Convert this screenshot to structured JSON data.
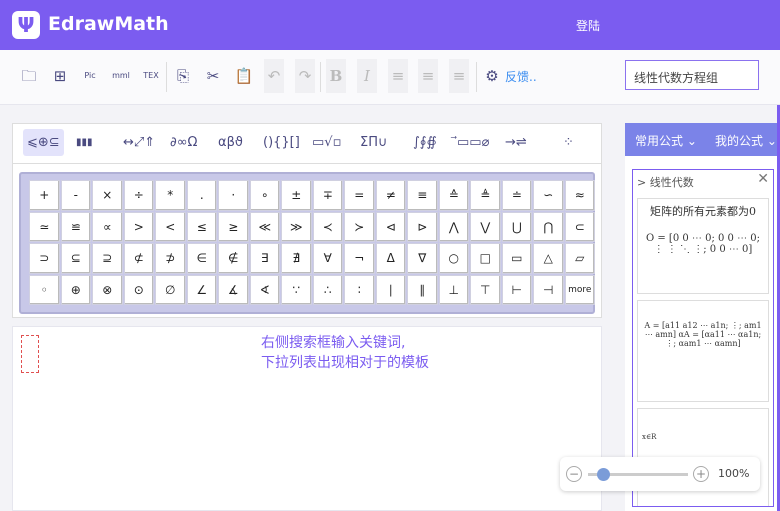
{
  "header": {
    "logo": "Ψ",
    "app_name": "EdrawMath",
    "login": "登陆"
  },
  "toolbar": {
    "items": [
      "open-folder",
      "new-file",
      "export-pic",
      "export-mml",
      "export-tex",
      "copy",
      "cut",
      "paste",
      "undo",
      "redo",
      "bold",
      "italic",
      "align-left",
      "align-center",
      "align-right"
    ],
    "feedback": "反馈..",
    "search_value": "线性代数方程组"
  },
  "symbol_tabs": [
    "⩽⊕⊆",
    "▮▮▮",
    "↔⤢⇑",
    "∂∞Ω",
    "αβϑ",
    "(){}[]",
    "▭√▫",
    "ΣΠ∪",
    "∫∮∯",
    "⃗▭▭⌀",
    "→⇌",
    "⁘"
  ],
  "symbols": [
    [
      "+",
      "-",
      "×",
      "÷",
      "*",
      ".",
      "·",
      "∘",
      "±",
      "∓",
      "=",
      "≠",
      "≡",
      "≙",
      "≜",
      "≐",
      "∽",
      "≈"
    ],
    [
      "≃",
      "≌",
      "∝",
      ">",
      "<",
      "≤",
      "≥",
      "≪",
      "≫",
      "≺",
      "≻",
      "⊲",
      "⊳",
      "⋀",
      "⋁",
      "⋃",
      "⋂",
      "⊂"
    ],
    [
      "⊃",
      "⊆",
      "⊇",
      "⊄",
      "⊅",
      "∈",
      "∉",
      "∃",
      "∄",
      "∀",
      "¬",
      "Δ",
      "∇",
      "○",
      "□",
      "▭",
      "△",
      "▱"
    ],
    [
      "◦",
      "⊕",
      "⊗",
      "⊙",
      "∅",
      "∠",
      "∡",
      "∢",
      "∵",
      "∴",
      "∶",
      "∣",
      "∥",
      "⊥",
      "⊤",
      "⊢",
      "⊣",
      "more"
    ]
  ],
  "canvas": {
    "hint_line1": "右侧搜索框输入关键词,",
    "hint_line2": "下拉列表出现相对于的模板"
  },
  "right_panel": {
    "tab1": "常用公式",
    "tab2": "我的公式",
    "category": "线性代数",
    "template1_title": "矩阵的所有元素都为0",
    "template1_formula": "O = [0 0 ⋯ 0; 0 0 ⋯ 0; ⋮ ⋮ ⋱ ⋮; 0 0 ⋯ 0]",
    "template2_formula": "A = [a11 a12 ⋯ a1n; ⋮; am1 ⋯ amn]  αA = [αa11 ⋯ αa1n; ⋮; αam1 ⋯ αamn]",
    "template3_formula": "x∈R"
  },
  "zoom": {
    "value": "100%",
    "fraction": 0.15
  }
}
